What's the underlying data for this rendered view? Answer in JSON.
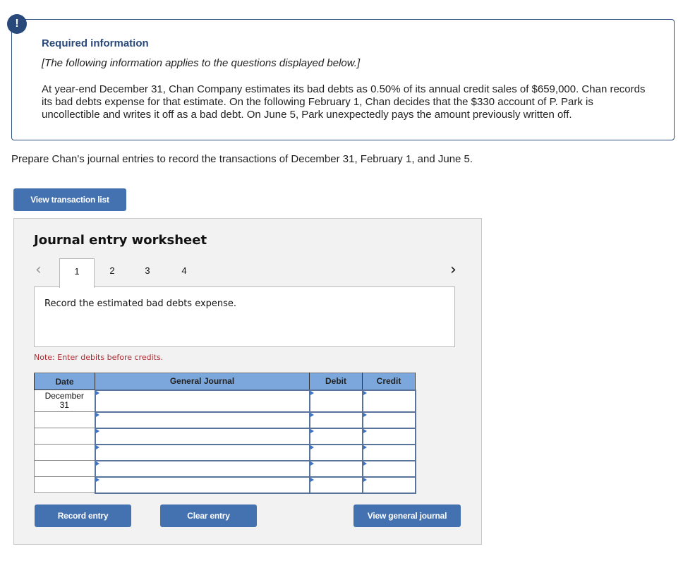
{
  "info": {
    "alert_icon": "!",
    "title": "Required information",
    "subtitle": "[The following information applies to the questions displayed below.]",
    "body": "At year-end December 31, Chan Company estimates its bad debts as 0.50% of its annual credit sales of $659,000. Chan records its bad debts expense for that estimate. On the following February 1, Chan decides that the $330 account of P. Park is uncollectible and writes it off as a bad debt. On June 5, Park unexpectedly pays the amount previously written off."
  },
  "prompt": "Prepare Chan's journal entries to record the transactions of December 31, February 1, and June 5.",
  "buttons": {
    "view_transaction_list": "View transaction list",
    "record_entry": "Record entry",
    "clear_entry": "Clear entry",
    "view_general_journal": "View general journal"
  },
  "worksheet": {
    "title": "Journal entry worksheet",
    "prev_icon": "‹",
    "next_icon": "›",
    "tabs": [
      {
        "label": "1",
        "active": true
      },
      {
        "label": "2",
        "active": false
      },
      {
        "label": "3",
        "active": false
      },
      {
        "label": "4",
        "active": false
      }
    ],
    "description": "Record the estimated bad debts expense.",
    "note": "Note: Enter debits before credits."
  },
  "table": {
    "headers": {
      "date": "Date",
      "account": "General Journal",
      "debit": "Debit",
      "credit": "Credit"
    },
    "rows": [
      {
        "date": "December 31",
        "account": "",
        "debit": "",
        "credit": ""
      },
      {
        "date": "",
        "account": "",
        "debit": "",
        "credit": ""
      },
      {
        "date": "",
        "account": "",
        "debit": "",
        "credit": ""
      },
      {
        "date": "",
        "account": "",
        "debit": "",
        "credit": ""
      },
      {
        "date": "",
        "account": "",
        "debit": "",
        "credit": ""
      },
      {
        "date": "",
        "account": "",
        "debit": "",
        "credit": ""
      }
    ]
  }
}
